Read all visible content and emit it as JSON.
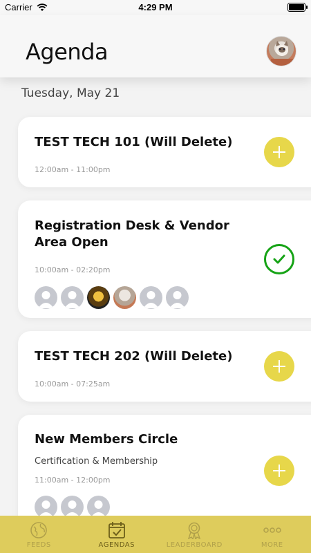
{
  "status_bar": {
    "carrier": "Carrier",
    "time": "4:29 PM"
  },
  "header": {
    "title": "Agenda"
  },
  "date": "Tuesday, May 21",
  "cards": [
    {
      "title": "TEST TECH 101 (Will Delete)",
      "time": "12:00am - 11:00pm",
      "action": "add"
    },
    {
      "title": "Registration Desk & Vendor Area Open",
      "time": "10:00am - 02:20pm",
      "action": "added"
    },
    {
      "title": "TEST TECH 202 (Will Delete)",
      "time": "10:00am - 07:25am",
      "action": "add"
    },
    {
      "title": "New Members Circle",
      "subtitle": "Certification & Membership",
      "time": "11:00am - 12:00pm",
      "action": "add"
    }
  ],
  "tabs": [
    {
      "label": "FEEDS",
      "icon": "globe-icon"
    },
    {
      "label": "AGENDAS",
      "icon": "calendar-check-icon"
    },
    {
      "label": "LEADERBOARD",
      "icon": "award-ribbon-icon"
    },
    {
      "label": "MORE",
      "icon": "more-dots-icon"
    }
  ],
  "colors": {
    "accent": "#decc5c",
    "add_button": "#e7d74a",
    "check": "#16a316"
  }
}
